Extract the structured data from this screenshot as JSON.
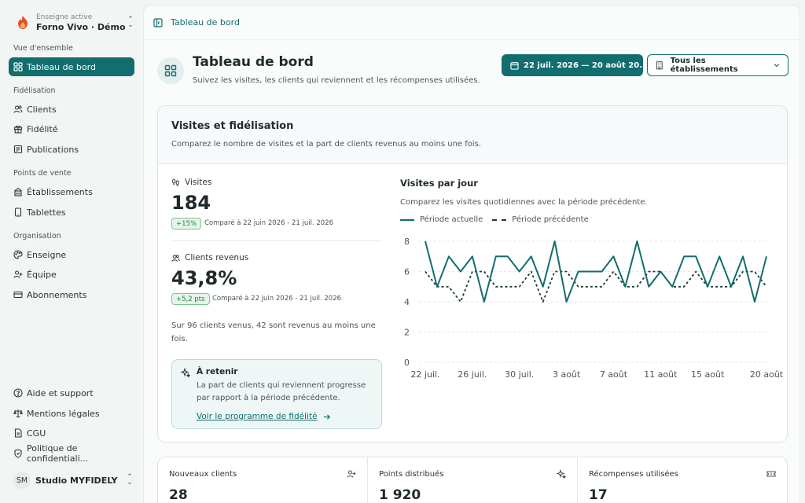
{
  "brand": {
    "subtitle": "Enseigne active",
    "name": "Forno Vivo · Démo"
  },
  "sidebar": {
    "sections": [
      {
        "title": "Vue d'ensemble",
        "items": [
          {
            "label": "Tableau de bord",
            "icon": "grid-icon",
            "active": true
          }
        ]
      },
      {
        "title": "Fidélisation",
        "items": [
          {
            "label": "Clients",
            "icon": "users-icon"
          },
          {
            "label": "Fidélité",
            "icon": "gift-icon"
          },
          {
            "label": "Publications",
            "icon": "newspaper-icon"
          }
        ]
      },
      {
        "title": "Points de vente",
        "items": [
          {
            "label": "Établissements",
            "icon": "building-icon"
          },
          {
            "label": "Tablettes",
            "icon": "tablet-icon"
          }
        ]
      },
      {
        "title": "Organisation",
        "items": [
          {
            "label": "Enseigne",
            "icon": "palette-icon"
          },
          {
            "label": "Équipe",
            "icon": "team-icon"
          },
          {
            "label": "Abonnements",
            "icon": "card-icon"
          }
        ]
      }
    ],
    "footer_items": [
      {
        "label": "Aide et support",
        "icon": "help-icon"
      },
      {
        "label": "Mentions légales",
        "icon": "scale-icon"
      },
      {
        "label": "CGU",
        "icon": "file-icon"
      },
      {
        "label": "Politique de confidentiali...",
        "icon": "shield-icon"
      }
    ],
    "user": {
      "initials": "SM",
      "name": "Studio MYFIDELY"
    }
  },
  "topbar": {
    "breadcrumb": "Tableau de bord"
  },
  "header": {
    "title": "Tableau de bord",
    "subtitle": "Suivez les visites, les clients qui reviennent et les récompenses utilisées.",
    "date_range": "22 juil. 2026 — 20 août 20...",
    "establishment": "Tous les établissements"
  },
  "card": {
    "title": "Visites et fidélisation",
    "subtitle": "Comparez le nombre de visites et la part de clients revenus au moins une fois.",
    "visits": {
      "label": "Visites",
      "value": "184",
      "badge": "+15%",
      "compare": "Comparé à 22 juin 2026 - 21 juil. 2026"
    },
    "returning": {
      "label": "Clients revenus",
      "value": "43,8%",
      "badge": "+5,2 pts",
      "compare": "Comparé à 22 juin 2026 - 21 juil. 2026"
    },
    "summary": "Sur 96 clients venus, 42 sont revenus au moins une fois.",
    "tip": {
      "title": "À retenir",
      "text": "La part de clients qui reviennent progresse par rapport à la période précédente.",
      "link": "Voir le programme de fidélité"
    },
    "chart_title": "Visites par jour",
    "chart_subtitle": "Comparez les visites quotidiennes avec la période précédente."
  },
  "stats": [
    {
      "label": "Nouveaux clients",
      "value": "28",
      "icon": "user-plus-icon"
    },
    {
      "label": "Points distribués",
      "value": "1 920",
      "icon": "sparkle-icon"
    },
    {
      "label": "Récompenses utilisées",
      "value": "17",
      "icon": "ticket-icon"
    }
  ],
  "colors": {
    "accent": "#116d6e",
    "badge_green": "#2a7d43"
  },
  "chart_data": {
    "type": "line",
    "x": [
      "22 juil.",
      "23 juil.",
      "24 juil.",
      "25 juil.",
      "26 juil.",
      "27 juil.",
      "28 juil.",
      "29 juil.",
      "30 juil.",
      "31 juil.",
      "1 août",
      "2 août",
      "3 août",
      "4 août",
      "5 août",
      "6 août",
      "7 août",
      "8 août",
      "9 août",
      "10 août",
      "11 août",
      "12 août",
      "13 août",
      "14 août",
      "15 août",
      "16 août",
      "17 août",
      "18 août",
      "19 août",
      "20 août"
    ],
    "tick_labels": [
      "22 juil.",
      "26 juil.",
      "30 juil.",
      "3 août",
      "7 août",
      "11 août",
      "15 août",
      "20 août"
    ],
    "tick_indices": [
      0,
      4,
      8,
      12,
      16,
      20,
      24,
      29
    ],
    "series": [
      {
        "name": "Période actuelle",
        "values": [
          8,
          5,
          7,
          6,
          7,
          4,
          7,
          7,
          6,
          7,
          5,
          8,
          4,
          6,
          6,
          6,
          7,
          5,
          8,
          5,
          6,
          5,
          7,
          7,
          5,
          7,
          5,
          7,
          4,
          7
        ],
        "color": "#116d6e",
        "style": "solid"
      },
      {
        "name": "Période précédente",
        "values": [
          6,
          5,
          5,
          4,
          6,
          6,
          5,
          5,
          5,
          6,
          4,
          6,
          6,
          5,
          5,
          5,
          6,
          5,
          5,
          6,
          6,
          5,
          5,
          6,
          5,
          5,
          5,
          6,
          6,
          5
        ],
        "color": "#1f3a3a",
        "style": "dashed"
      }
    ],
    "ylim": [
      0,
      8
    ],
    "yticks": [
      0,
      2,
      4,
      6,
      8
    ],
    "grid": true,
    "legend": "top-left"
  }
}
